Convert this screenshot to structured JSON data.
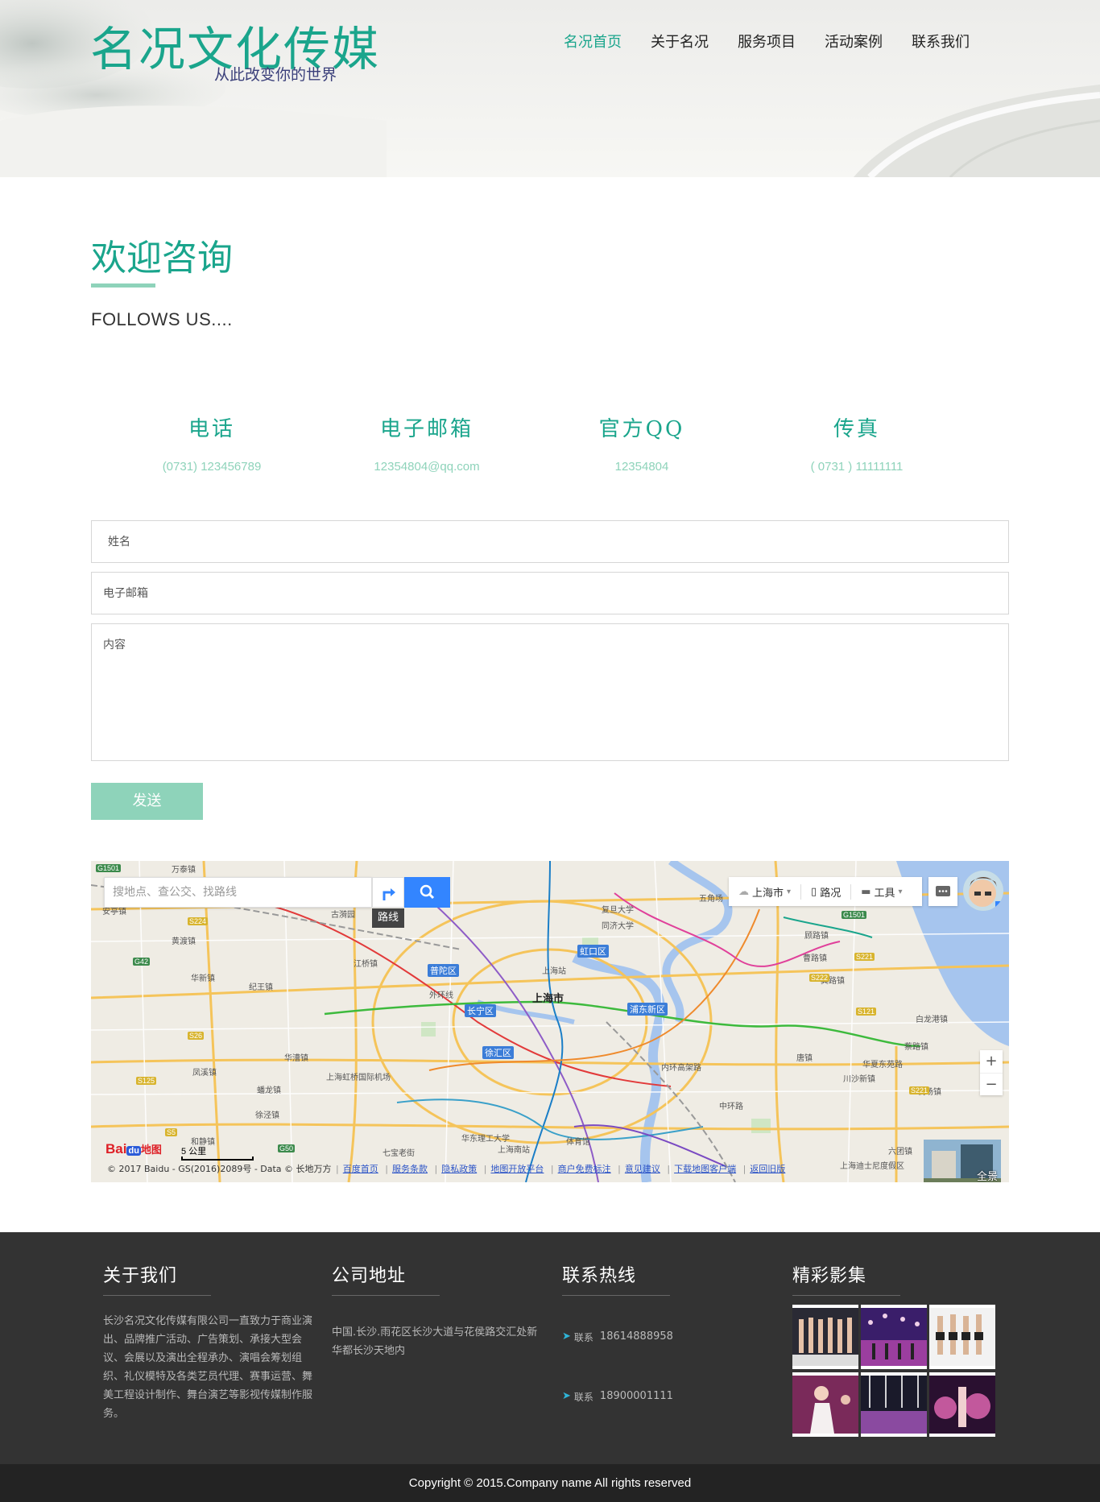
{
  "header": {
    "brand": "名况文化传媒",
    "slogan": "从此改变你的世界",
    "nav": [
      {
        "label": "名况首页",
        "active": true
      },
      {
        "label": "关于名况",
        "active": false
      },
      {
        "label": "服务项目",
        "active": false
      },
      {
        "label": "活动案例",
        "active": false
      },
      {
        "label": "联系我们",
        "active": false
      }
    ]
  },
  "contact": {
    "title": "欢迎咨询",
    "subtitle": "FOLLOWS US....",
    "items": [
      {
        "label": "电话",
        "value": "(0731) 123456789"
      },
      {
        "label": "电子邮箱",
        "value": "12354804@qq.com"
      },
      {
        "label": "官方QQ",
        "value": "12354804"
      },
      {
        "label": "传真",
        "value": "( 0731 ) 11111111"
      }
    ],
    "form": {
      "name_placeholder": "姓名",
      "email_placeholder": "电子邮箱",
      "message_placeholder": "内容",
      "submit_label": "发送"
    }
  },
  "map": {
    "search_placeholder": "搜地点、查公交、找路线",
    "route_tip": "路线",
    "city": "上海市",
    "traffic": "路况",
    "tools": "工具",
    "center_label": "上海市",
    "scale": "5 公里",
    "panorama": "全景",
    "copyright": "© 2017 Baidu - GS(2016)2089号 - Data © 长地万方",
    "footer_links": [
      "百度首页",
      "服务条款",
      "隐私政策",
      "地图开放平台",
      "商户免费标注",
      "意见建议",
      "下载地图客户端",
      "返回旧版"
    ],
    "logo_text": "Bai",
    "logo_du": "du",
    "logo_suffix": "地图",
    "districts": [
      "普陀区",
      "虹口区",
      "长宁区",
      "浦东新区",
      "徐汇区"
    ],
    "places": [
      "万泰镇",
      "安亭镇",
      "黄渡镇",
      "华新镇",
      "纪王镇",
      "江桥镇",
      "古漪园",
      "复旦大学",
      "同济大学",
      "五角场",
      "上海站",
      "上海虹桥国际机场",
      "华漕镇",
      "凤溪镇",
      "蟠龙镇",
      "徐泾镇",
      "和静镇",
      "七宝老街",
      "上海南站",
      "华东理工大学",
      "体育馆",
      "唐镇",
      "川沙新镇",
      "白龙港镇",
      "蔡路镇",
      "六团镇",
      "曹路镇",
      "龚路镇",
      "顾路镇",
      "机场镇",
      "华夏东苑路",
      "内环高架路",
      "中环路",
      "外环线",
      "上海迪士尼度假区"
    ],
    "roads": [
      "G1501",
      "S224",
      "G42",
      "S26",
      "S125",
      "S5",
      "G50",
      "G1501",
      "S221",
      "S222",
      "S121",
      "S221"
    ]
  },
  "footer": {
    "about": {
      "title": "关于我们",
      "text": "长沙名况文化传媒有限公司一直致力于商业演出、品牌推广活动、广告策划、承接大型会议、会展以及演出全程承办、演唱会筹划组织、礼仪模特及各类艺员代理、赛事运营、舞美工程设计制作、舞台演艺等影视传媒制作服务。"
    },
    "address": {
      "title": "公司地址",
      "text": "中国.长沙.雨花区长沙大道与花侯路交汇处新华都长沙天地内"
    },
    "hotline": {
      "title": "联系热线",
      "items": [
        {
          "label": "联系",
          "phone": "18614888958"
        },
        {
          "label": "联系",
          "phone": "18900001111"
        }
      ]
    },
    "gallery": {
      "title": "精彩影集"
    }
  },
  "copyright": "Copyright © 2015.Company name All rights reserved"
}
